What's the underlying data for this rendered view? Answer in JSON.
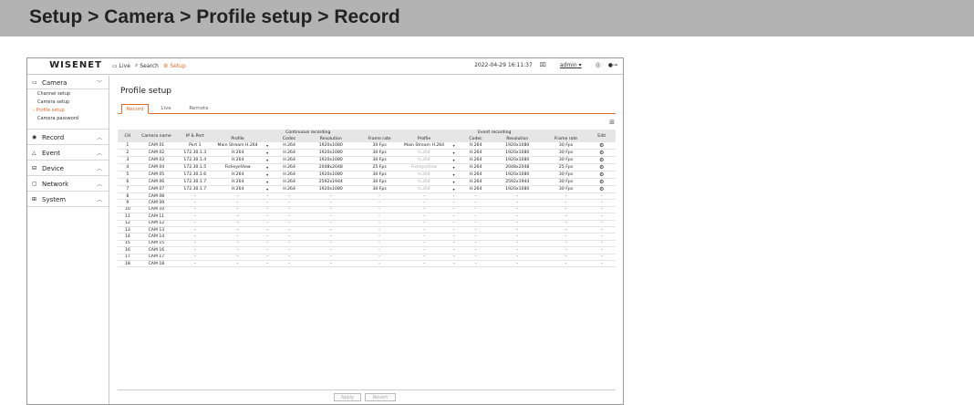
{
  "banner": {
    "title": "Setup > Camera > Profile setup > Record"
  },
  "topbar": {
    "logo": "WISENET",
    "nav": [
      {
        "icon": "monitor-icon",
        "label": "Live"
      },
      {
        "icon": "search-icon",
        "label": "Search"
      },
      {
        "icon": "gear-icon",
        "label": "Setup"
      }
    ],
    "datetime": "2022-04-29 16:11:37",
    "user": "admin"
  },
  "sidebar": {
    "groups": [
      {
        "label": "Camera",
        "icon": "camera-icon",
        "expanded": true,
        "items": [
          "Channel setup",
          "Camera setup",
          "Profile setup",
          "Camera password"
        ],
        "active_item": "Profile setup"
      },
      {
        "label": "Record",
        "icon": "record-icon",
        "expanded": false
      },
      {
        "label": "Event",
        "icon": "event-icon",
        "expanded": false
      },
      {
        "label": "Device",
        "icon": "device-icon",
        "expanded": false
      },
      {
        "label": "Network",
        "icon": "network-icon",
        "expanded": false
      },
      {
        "label": "System",
        "icon": "system-icon",
        "expanded": false
      }
    ]
  },
  "main": {
    "title": "Profile setup",
    "tabs": [
      "Record",
      "Live",
      "Remote"
    ],
    "active_tab": "Record",
    "table": {
      "group_headers": {
        "continuous": "Continuous recording",
        "event": "Event recording"
      },
      "headers": {
        "ch": "CH",
        "camera_name": "Camera name",
        "ip_port": "IP & Port",
        "profile": "Profile",
        "codec": "Codec",
        "resolution": "Resolution",
        "frame_rate": "Frame rate",
        "edit": "Edit"
      },
      "rows": [
        [
          "1",
          "CAM 01",
          "Port 1",
          "Main Stream H.264",
          "H.264",
          "1920x1080",
          "30 Fps",
          "Main Stream H.264",
          "H.264",
          "1920x1080",
          "30 Fps"
        ],
        [
          "2",
          "CAM 02",
          "172.30.1.3",
          "H.264",
          "H.264",
          "1920x1080",
          "30 Fps",
          "H.264",
          "H.264",
          "1920x1080",
          "30 Fps"
        ],
        [
          "3",
          "CAM 03",
          "172.30.1.4",
          "H.264",
          "H.264",
          "1920x1080",
          "30 Fps",
          "H.264",
          "H.264",
          "1920x1080",
          "30 Fps"
        ],
        [
          "4",
          "CAM 04",
          "172.30.1.5",
          "FisheyeView",
          "H.264",
          "2048x2048",
          "25 Fps",
          "FisheyeView",
          "H.264",
          "2048x2048",
          "25 Fps"
        ],
        [
          "5",
          "CAM 05",
          "172.30.1.6",
          "H.264",
          "H.264",
          "1920x1080",
          "30 Fps",
          "H.264",
          "H.264",
          "1920x1080",
          "30 Fps"
        ],
        [
          "6",
          "CAM 06",
          "172.30.1.7",
          "H.264",
          "H.264",
          "2592x1944",
          "30 Fps",
          "H.264",
          "H.264",
          "2592x1944",
          "30 Fps"
        ],
        [
          "7",
          "CAM 07",
          "172.30.1.7",
          "H.264",
          "H.264",
          "1920x1080",
          "30 Fps",
          "H.264",
          "H.264",
          "1920x1080",
          "30 Fps"
        ],
        [
          "8",
          "CAM 08",
          "-",
          "-",
          "-",
          "-",
          "-",
          "-",
          "-",
          "-",
          "-"
        ],
        [
          "9",
          "CAM 09",
          "-",
          "-",
          "-",
          "-",
          "-",
          "-",
          "-",
          "-",
          "-"
        ],
        [
          "10",
          "CAM 10",
          "-",
          "-",
          "-",
          "-",
          "-",
          "-",
          "-",
          "-",
          "-"
        ],
        [
          "11",
          "CAM 11",
          "-",
          "-",
          "-",
          "-",
          "-",
          "-",
          "-",
          "-",
          "-"
        ],
        [
          "12",
          "CAM 12",
          "-",
          "-",
          "-",
          "-",
          "-",
          "-",
          "-",
          "-",
          "-"
        ],
        [
          "13",
          "CAM 13",
          "-",
          "-",
          "-",
          "-",
          "-",
          "-",
          "-",
          "-",
          "-"
        ],
        [
          "14",
          "CAM 14",
          "-",
          "-",
          "-",
          "-",
          "-",
          "-",
          "-",
          "-",
          "-"
        ],
        [
          "15",
          "CAM 15",
          "-",
          "-",
          "-",
          "-",
          "-",
          "-",
          "-",
          "-",
          "-"
        ],
        [
          "16",
          "CAM 16",
          "-",
          "-",
          "-",
          "-",
          "-",
          "-",
          "-",
          "-",
          "-"
        ],
        [
          "17",
          "CAM 17",
          "-",
          "-",
          "-",
          "-",
          "-",
          "-",
          "-",
          "-",
          "-"
        ],
        [
          "18",
          "CAM 18",
          "-",
          "-",
          "-",
          "-",
          "-",
          "-",
          "-",
          "-",
          "-"
        ]
      ],
      "active_rows": 7
    },
    "buttons": {
      "apply": "Apply",
      "revert": "Revert"
    }
  },
  "colors": {
    "accent": "#e06c2a",
    "banner": "#b3b3b3"
  }
}
